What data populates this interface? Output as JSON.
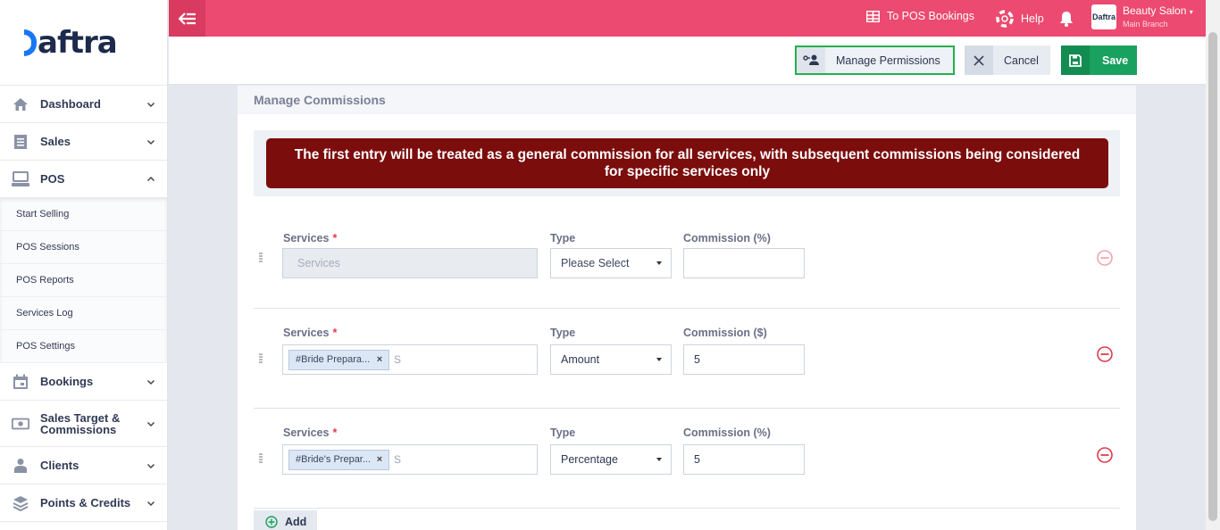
{
  "brand": {
    "logo_text": "aftra"
  },
  "sidebar": {
    "items": [
      {
        "label": "Dashboard"
      },
      {
        "label": "Sales"
      },
      {
        "label": "POS"
      },
      {
        "label": "Bookings"
      },
      {
        "label": "Sales Target & Commissions"
      },
      {
        "label": "Clients"
      },
      {
        "label": "Points & Credits"
      }
    ],
    "pos_sub": [
      {
        "label": "Start Selling"
      },
      {
        "label": "POS Sessions"
      },
      {
        "label": "POS Reports"
      },
      {
        "label": "Services Log"
      },
      {
        "label": "POS Settings"
      }
    ]
  },
  "topbar": {
    "pos_bookings": "To POS Bookings",
    "help": "Help",
    "user_name": "Beauty Salon",
    "user_branch": "Main Branch",
    "avatar_text": "Daftra"
  },
  "actions": {
    "manage_permissions": "Manage Permissions",
    "cancel": "Cancel",
    "save": "Save"
  },
  "panel": {
    "title": "Manage Commissions",
    "alert": "The first entry will be treated as a general commission for all services, with subsequent commissions being considered for specific services only",
    "add_label": "Add"
  },
  "rows": [
    {
      "services_label": "Services",
      "required_mark": "*",
      "services_placeholder": "Services",
      "type_label": "Type",
      "type_value": "Please Select",
      "commission_label": "Commission (%)",
      "commission_value": ""
    },
    {
      "services_label": "Services",
      "required_mark": "*",
      "tag": "#Bride Prepara...",
      "tag_remove": "×",
      "search_hint": "S",
      "type_label": "Type",
      "type_value": "Amount",
      "commission_label": "Commission ($)",
      "commission_value": "5"
    },
    {
      "services_label": "Services",
      "required_mark": "*",
      "tag": "#Bride's Prepar...",
      "tag_remove": "×",
      "search_hint": "S",
      "type_label": "Type",
      "type_value": "Percentage",
      "commission_label": "Commission (%)",
      "commission_value": "5"
    }
  ],
  "colors": {
    "topbar": "#ec4a70",
    "alert": "#7b0d0d",
    "save": "#18a15f",
    "permission_border": "#23b14d",
    "remove_active": "#e03a4e",
    "remove_disabled": "#f3a3ad"
  }
}
